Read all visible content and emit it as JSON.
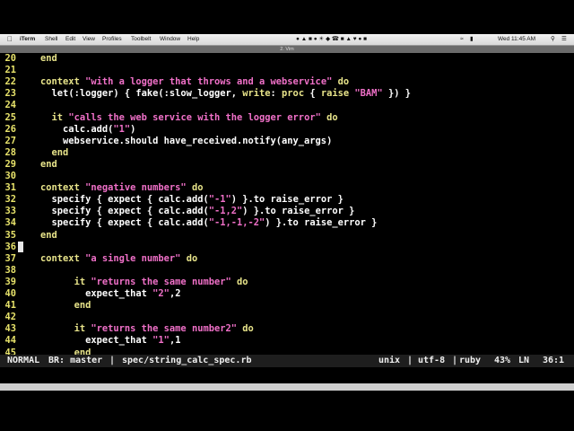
{
  "menubar": {
    "app": "iTerm",
    "items": [
      "Shell",
      "Edit",
      "View",
      "Profiles",
      "Toolbelt",
      "Window",
      "Help"
    ],
    "clock": "Wed 11:45 AM",
    "window_title": "2. Vim"
  },
  "lines": [
    {
      "n": "20",
      "indent": "    ",
      "tokens": [
        [
          "k",
          "end"
        ]
      ]
    },
    {
      "n": "21",
      "indent": "",
      "tokens": []
    },
    {
      "n": "22",
      "indent": "    ",
      "tokens": [
        [
          "k",
          "context "
        ],
        [
          "s",
          "\"with a logger that throws and a webservice\""
        ],
        [
          "k",
          " do"
        ]
      ]
    },
    {
      "n": "23",
      "indent": "      ",
      "tokens": [
        [
          "n",
          "let(:logger) { fake(:slow_logger, "
        ],
        [
          "k",
          "write"
        ],
        [
          "n",
          ": "
        ],
        [
          "k",
          "proc"
        ],
        [
          "n",
          " { "
        ],
        [
          "k",
          "raise"
        ],
        [
          "n",
          " "
        ],
        [
          "s",
          "\"BAM\""
        ],
        [
          "n",
          " }) }"
        ]
      ]
    },
    {
      "n": "24",
      "indent": "",
      "tokens": []
    },
    {
      "n": "25",
      "indent": "      ",
      "tokens": [
        [
          "k",
          "it "
        ],
        [
          "s",
          "\"calls the web service with the logger error\""
        ],
        [
          "k",
          " do"
        ]
      ]
    },
    {
      "n": "26",
      "indent": "        ",
      "tokens": [
        [
          "n",
          "calc.add("
        ],
        [
          "s",
          "\"1\""
        ],
        [
          "n",
          ")"
        ]
      ]
    },
    {
      "n": "27",
      "indent": "        ",
      "tokens": [
        [
          "n",
          "webservice.should have_received.notify(any_args)"
        ]
      ]
    },
    {
      "n": "28",
      "indent": "      ",
      "tokens": [
        [
          "k",
          "end"
        ]
      ]
    },
    {
      "n": "29",
      "indent": "    ",
      "tokens": [
        [
          "k",
          "end"
        ]
      ]
    },
    {
      "n": "30",
      "indent": "",
      "tokens": []
    },
    {
      "n": "31",
      "indent": "    ",
      "tokens": [
        [
          "k",
          "context "
        ],
        [
          "s",
          "\"negative numbers\""
        ],
        [
          "k",
          " do"
        ]
      ]
    },
    {
      "n": "32",
      "indent": "      ",
      "tokens": [
        [
          "n",
          "specify { expect { calc.add("
        ],
        [
          "s",
          "\"-1\""
        ],
        [
          "n",
          ") }.to raise_error }"
        ]
      ]
    },
    {
      "n": "33",
      "indent": "      ",
      "tokens": [
        [
          "n",
          "specify { expect { calc.add("
        ],
        [
          "s",
          "\"-1,2\""
        ],
        [
          "n",
          ") }.to raise_error }"
        ]
      ]
    },
    {
      "n": "34",
      "indent": "      ",
      "tokens": [
        [
          "n",
          "specify { expect { calc.add("
        ],
        [
          "s",
          "\"-1,-1,-2\""
        ],
        [
          "n",
          ") }.to raise_error }"
        ]
      ]
    },
    {
      "n": "35",
      "indent": "    ",
      "tokens": [
        [
          "k",
          "end"
        ]
      ]
    },
    {
      "n": "36",
      "indent": "",
      "tokens": [],
      "cursor": true
    },
    {
      "n": "37",
      "indent": "    ",
      "tokens": [
        [
          "k",
          "context "
        ],
        [
          "s",
          "\"a single number\""
        ],
        [
          "k",
          " do"
        ]
      ]
    },
    {
      "n": "38",
      "indent": "",
      "tokens": []
    },
    {
      "n": "39",
      "indent": "          ",
      "tokens": [
        [
          "k",
          "it "
        ],
        [
          "s",
          "\"returns the same number\""
        ],
        [
          "k",
          " do"
        ]
      ]
    },
    {
      "n": "40",
      "indent": "            ",
      "tokens": [
        [
          "n",
          "expect_that "
        ],
        [
          "s",
          "\"2\""
        ],
        [
          "n",
          ",2"
        ]
      ]
    },
    {
      "n": "41",
      "indent": "          ",
      "tokens": [
        [
          "k",
          "end"
        ]
      ]
    },
    {
      "n": "42",
      "indent": "",
      "tokens": []
    },
    {
      "n": "43",
      "indent": "          ",
      "tokens": [
        [
          "k",
          "it "
        ],
        [
          "s",
          "\"returns the same number2\""
        ],
        [
          "k",
          " do"
        ]
      ]
    },
    {
      "n": "44",
      "indent": "            ",
      "tokens": [
        [
          "n",
          "expect_that "
        ],
        [
          "s",
          "\"1\""
        ],
        [
          "n",
          ",1"
        ]
      ]
    },
    {
      "n": "45",
      "indent": "          ",
      "tokens": [
        [
          "k",
          "end"
        ]
      ]
    }
  ],
  "statusline": {
    "mode": "NORMAL",
    "branch": "BR: master",
    "separator": "|",
    "file": "spec/string_calc_spec.rb",
    "format": "unix",
    "encoding": "utf-8",
    "filetype": "ruby",
    "percent": "43%",
    "ln_label": "LN",
    "position": "36:1"
  },
  "colors": {
    "keyword": "#e8e48a",
    "string": "#f070c8",
    "line_number": "#e7e26a",
    "background": "#000000"
  }
}
